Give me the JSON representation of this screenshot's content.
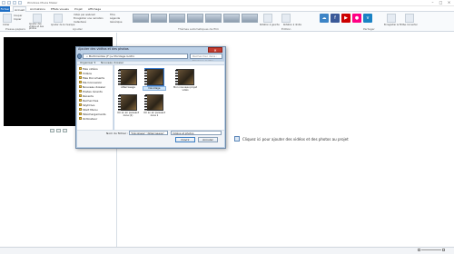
{
  "app": {
    "title": "Windows Movie Maker"
  },
  "window_controls": {
    "minimize": "–",
    "maximize": "□",
    "close": "×"
  },
  "tabs": {
    "file": "Fichier",
    "items": [
      "Accueil",
      "Animations",
      "Effets visuels",
      "Projet",
      "Affichage"
    ]
  },
  "ribbon": {
    "clipboard": {
      "cut": "Couper",
      "copy": "Copier",
      "paste": "Coller",
      "label": "Presse-papiers"
    },
    "add": {
      "videos_photos": "Ajouter des vidéos et des photos",
      "music": "Ajouter de la musique",
      "webcam_video": "Vidéo par webcam",
      "narration": "Enregistrer une narration",
      "snapshot": "Instantané",
      "title": "Titre",
      "caption": "Légende",
      "credits": "Générique",
      "label": "Ajouter"
    },
    "themes": {
      "label": "Thèmes automatiques de film"
    },
    "editing": {
      "rotate_left": "Rotation à gauche",
      "rotate_right": "Rotation à droite",
      "label": "Édition"
    },
    "share": {
      "label": "Partager",
      "save_movie": "Enregistrer le film",
      "sign_in": "Se connecter"
    }
  },
  "storyboard": {
    "hint": "Cliquez ici pour ajouter des vidéos et des photos au projet"
  },
  "dialog": {
    "title": "Ajouter des vidéos et des photos",
    "address": "« Multimédias (F:) ▸ Montage GoPro",
    "search_placeholder": "Rechercher dans : Montage GoPro",
    "toolbar": {
      "organize": "Organiser ▾",
      "new_folder": "Nouveau dossier"
    },
    "nav_items": [
      "Mes vidéos",
      "Vidéos",
      "Mes Documents",
      "Ma Connexion",
      "Nouveau dossier",
      "Postes récents",
      "Récents",
      "Recherches",
      "SkyDrive",
      "Start Menu",
      "Téléchargements",
      "Ordinateur"
    ],
    "files": [
      {
        "name": "Atterrissage",
        "selected": false
      },
      {
        "name": "Décollage",
        "selected": true
      },
      {
        "name": "Mon nouveau projet vidéo",
        "selected": false
      },
      {
        "name": "Vol en air puissant zone (2)",
        "selected": false
      },
      {
        "name": "Vol en air puissant zone 1",
        "selected": false
      }
    ],
    "filename_label": "Nom du fichier :",
    "filename_value": "\"Décollage\" \"Atterrissage\"",
    "filetype": "Vidéos et photos",
    "open_button": "Ouvrir",
    "cancel_button": "Annuler"
  },
  "colors": {
    "accent": "#1f6fc5",
    "dialog_frame": "#bcd0e6",
    "close_red": "#c43b2e"
  }
}
